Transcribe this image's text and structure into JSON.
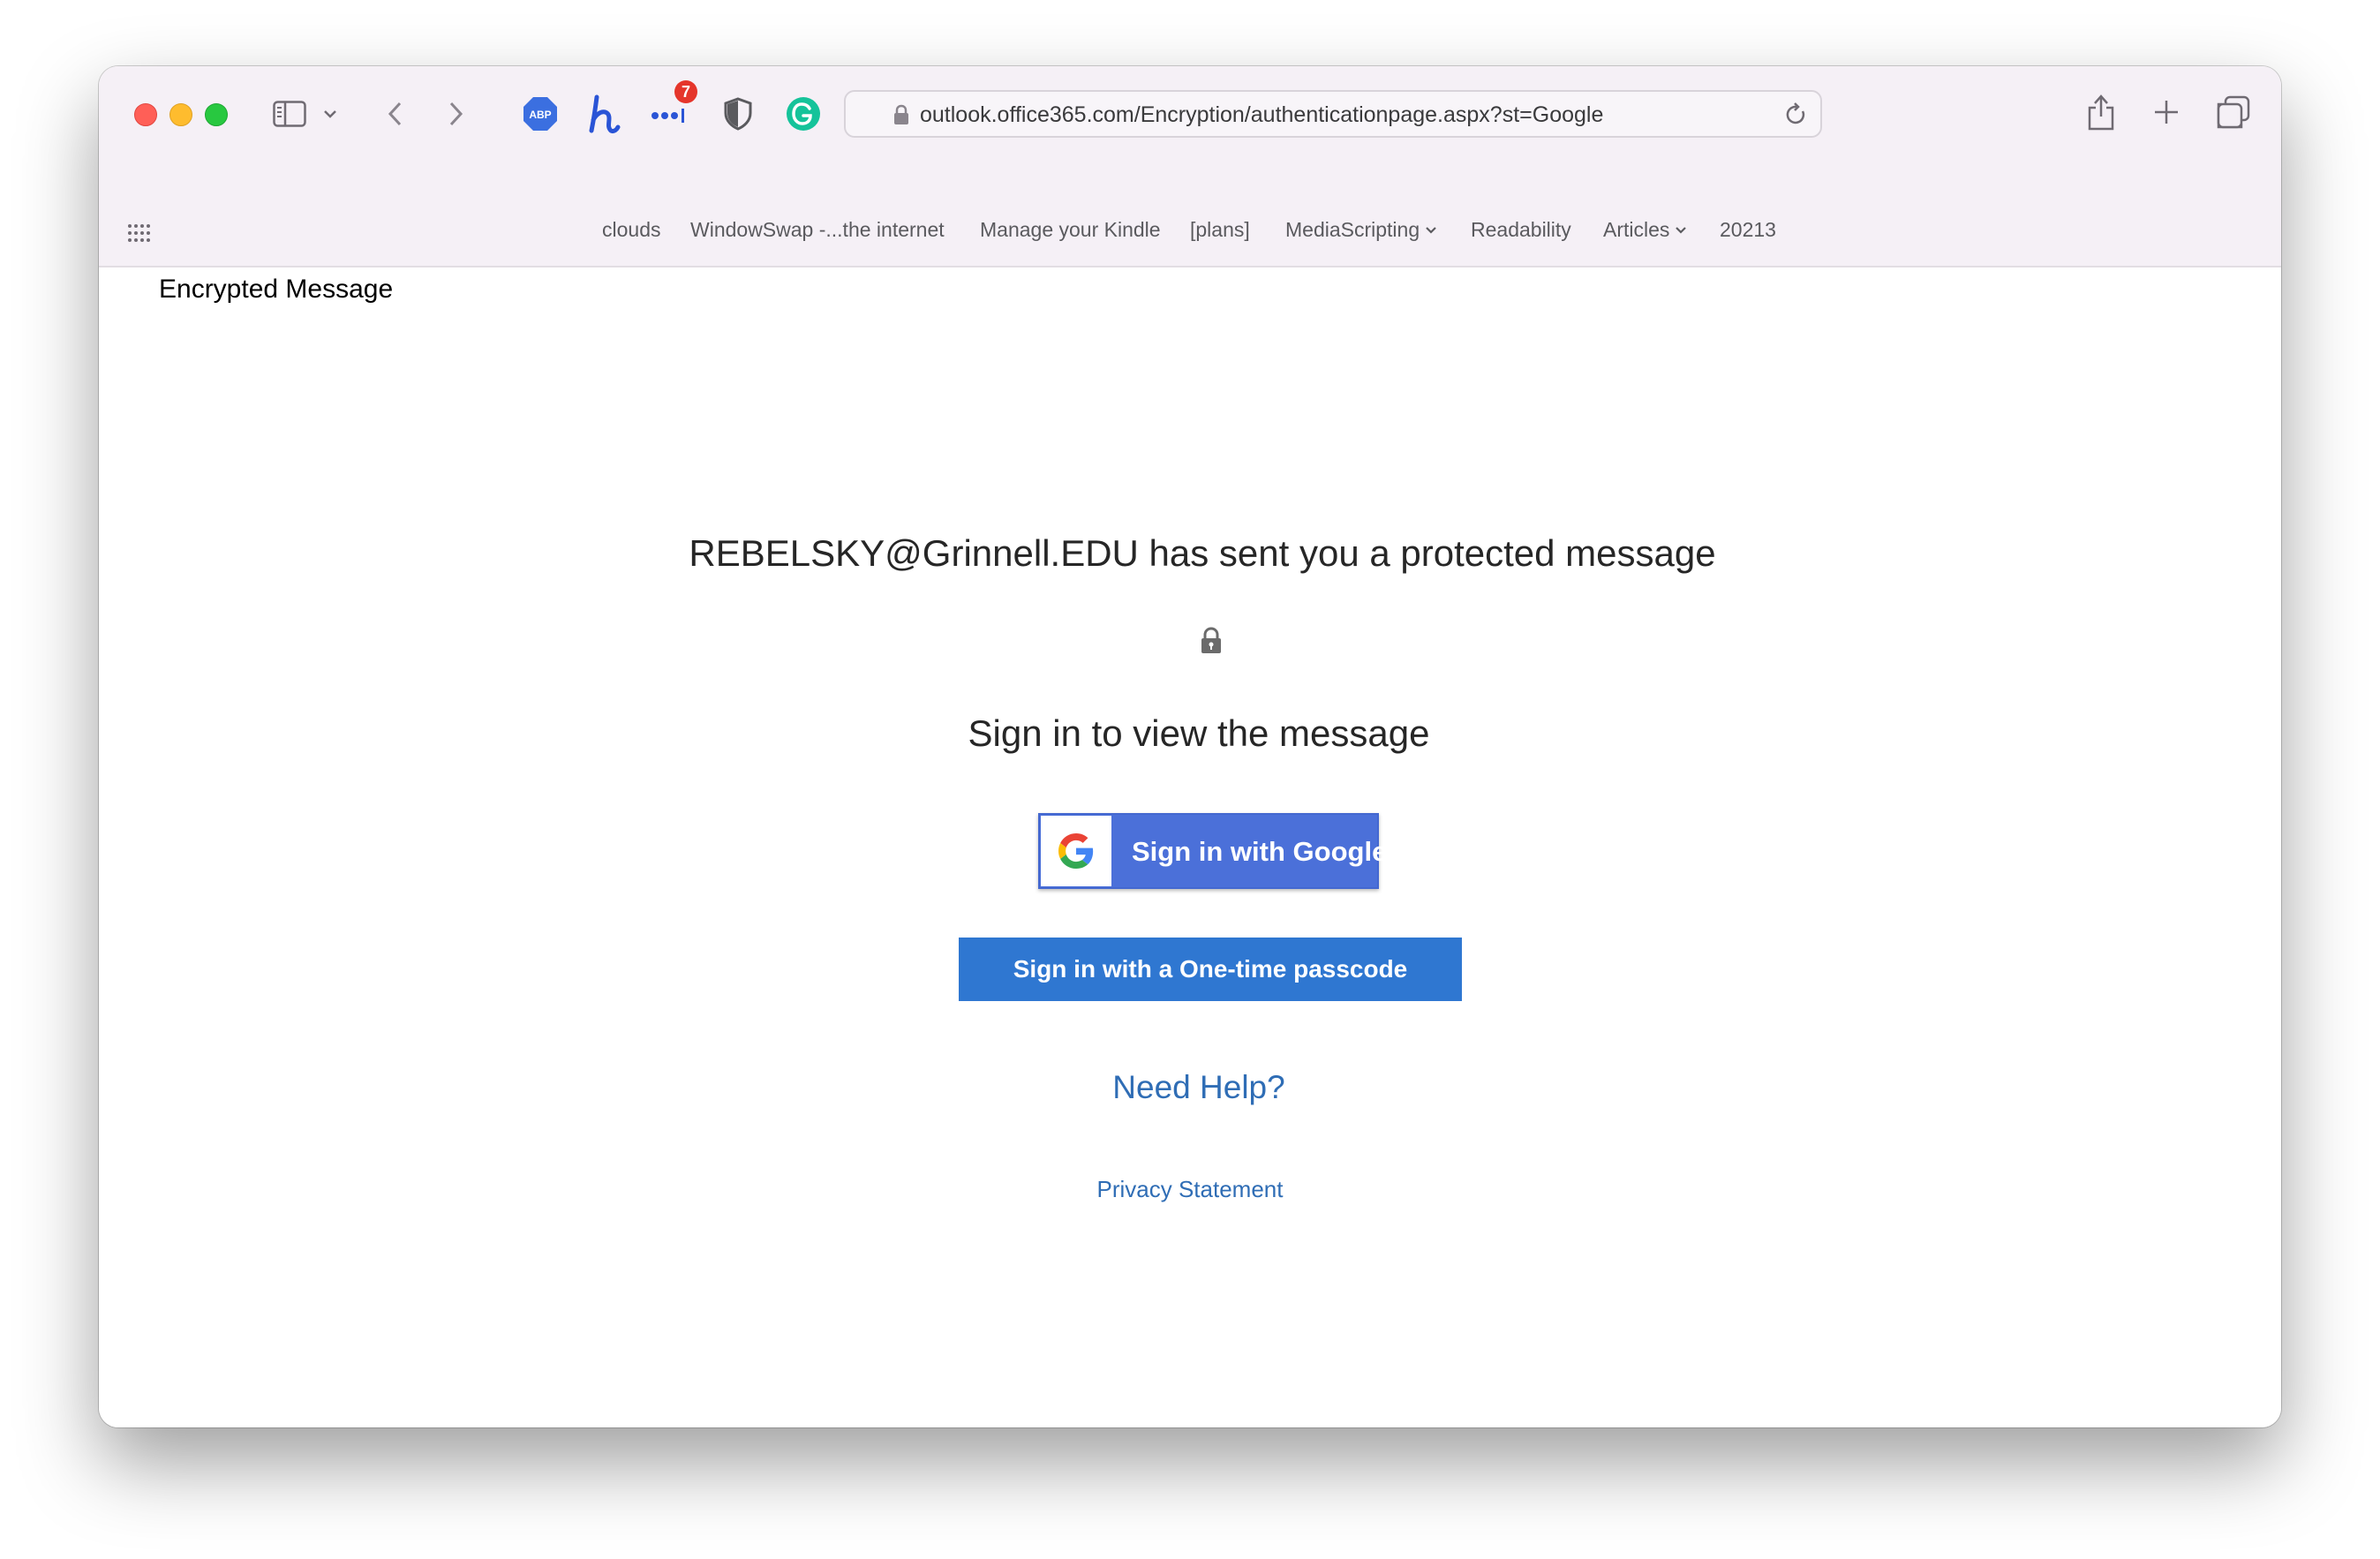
{
  "browser": {
    "url": "outlook.office365.com/Encryption/authenticationpage.aspx?st=Google",
    "bookmarks": [
      {
        "label": "clouds"
      },
      {
        "label": "WindowSwap -...the internet"
      },
      {
        "label": "Manage your Kindle"
      },
      {
        "label": "[plans]"
      },
      {
        "label": "MediaScripting"
      },
      {
        "label": "Readability"
      },
      {
        "label": "Articles"
      },
      {
        "label": "20213"
      }
    ],
    "extension_badge_count": "7",
    "abp_label": "ABP",
    "icons": [
      "sidebar-icon",
      "chevron-down-icon",
      "back-icon",
      "forward-icon",
      "adblock-icon",
      "honey-icon",
      "dots-icon",
      "shield-icon",
      "grammarly-icon",
      "lock-icon",
      "reload-icon",
      "share-icon",
      "plus-icon",
      "tabs-icon",
      "grid-icon"
    ]
  },
  "page": {
    "title": "Encrypted Message",
    "sender_line": "REBELSKY@Grinnell.EDU has sent you a protected message",
    "subheading": "Sign in to view the message",
    "google_button": "Sign in with Google",
    "otp_button": "Sign in with a One-time passcode",
    "need_help": "Need Help?",
    "privacy": "Privacy Statement"
  },
  "colors": {
    "google_button_bg": "#4b70d9",
    "otp_button_bg": "#2f77d1",
    "link": "#2f6db5",
    "toolbar_bg": "#f5f0f6"
  }
}
